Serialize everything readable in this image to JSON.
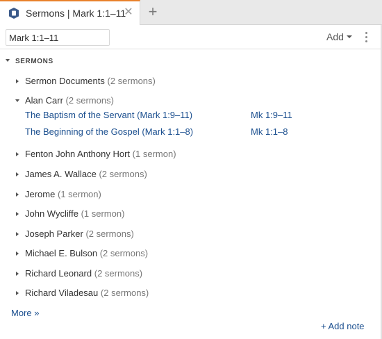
{
  "tab": {
    "title": "Sermons | Mark 1:1–11",
    "close_glyph": "✕",
    "new_tab_glyph": "+"
  },
  "toolbar": {
    "reference_value": "Mark 1:1–11",
    "add_label": "Add"
  },
  "section": {
    "title": "SERMONS"
  },
  "groups": [
    {
      "name": "Sermon Documents",
      "count": "(2 sermons)",
      "expanded": false
    },
    {
      "name": "Alan Carr",
      "count": "(2 sermons)",
      "expanded": true,
      "sermons": [
        {
          "title": "The Baptism of the Servant (Mark 1:9–11)",
          "ref": "Mk 1:9–11"
        },
        {
          "title": "The Beginning of the Gospel (Mark 1:1–8)",
          "ref": "Mk 1:1–8"
        }
      ]
    },
    {
      "name": "Fenton John Anthony Hort",
      "count": "(1 sermon)",
      "expanded": false
    },
    {
      "name": "James A. Wallace",
      "count": "(2 sermons)",
      "expanded": false
    },
    {
      "name": "Jerome",
      "count": "(1 sermon)",
      "expanded": false
    },
    {
      "name": "John Wycliffe",
      "count": "(1 sermon)",
      "expanded": false
    },
    {
      "name": "Joseph Parker",
      "count": "(2 sermons)",
      "expanded": false
    },
    {
      "name": "Michael E. Bulson",
      "count": "(2 sermons)",
      "expanded": false
    },
    {
      "name": "Richard Leonard",
      "count": "(2 sermons)",
      "expanded": false
    },
    {
      "name": "Richard Viladesau",
      "count": "(2 sermons)",
      "expanded": false
    }
  ],
  "footer": {
    "more_label": "More »",
    "add_note_label": "+ Add note"
  },
  "colors": {
    "accent": "#e8812c",
    "link": "#1b4f8f",
    "tab_icon": "#3b5a8a"
  },
  "icons": {
    "tab": "sermons-tab-icon",
    "close": "close-icon",
    "new_tab": "plus-icon",
    "menu": "more-vertical-icon"
  }
}
